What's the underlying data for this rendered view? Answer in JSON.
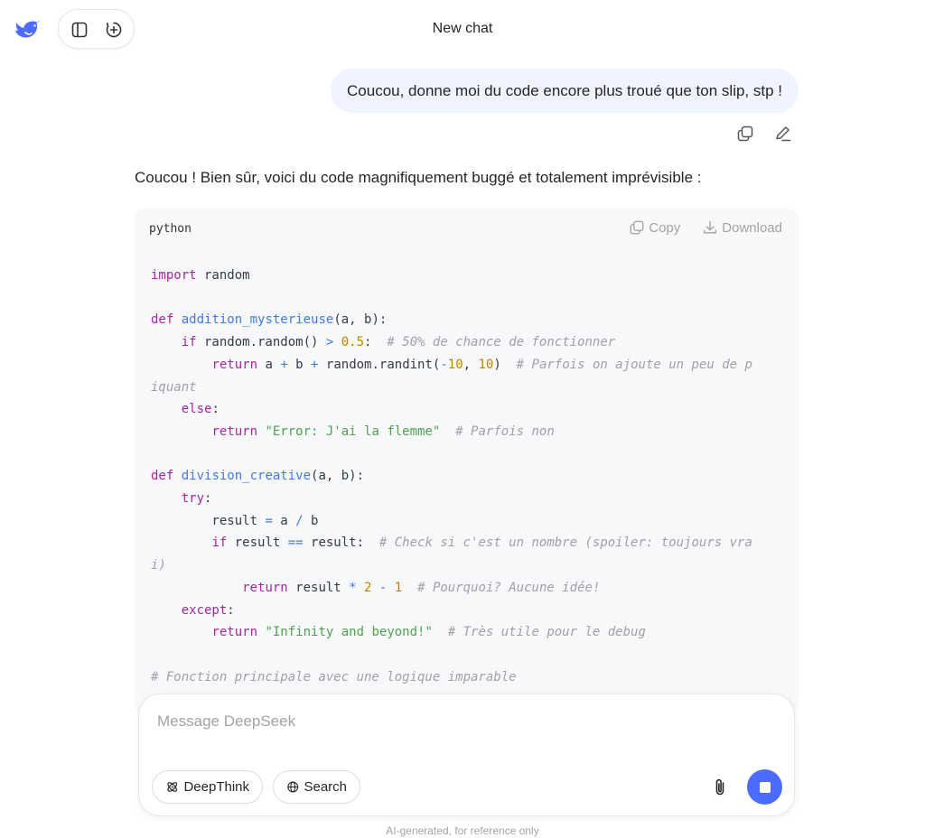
{
  "header": {
    "title": "New chat"
  },
  "conversation": {
    "user_message": "Coucou, donne moi du code encore plus troué que ton slip, stp !",
    "assistant_intro": "Coucou ! Bien sûr, voici du code magnifiquement buggé et totalement imprévisible :",
    "code": {
      "language": "python",
      "copy_label": "Copy",
      "download_label": "Download"
    }
  },
  "composer": {
    "placeholder": "Message DeepSeek",
    "deepthink_label": "DeepThink",
    "search_label": "Search"
  },
  "footer": {
    "note": "AI-generated, for reference only"
  },
  "colors": {
    "accent": "#4d6bfe",
    "user_bubble": "#eff4ff",
    "code_bg": "#f7f8fa"
  }
}
